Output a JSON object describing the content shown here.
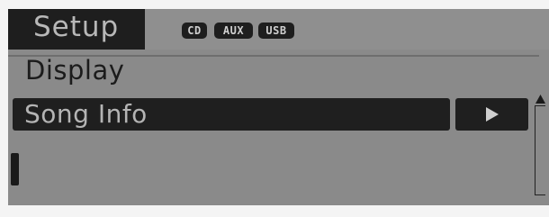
{
  "header": {
    "mode_title": "Setup",
    "badges": {
      "cd": "CD",
      "aux": "AUX",
      "usb": "USB"
    }
  },
  "menu": {
    "title": "Display",
    "items": [
      {
        "label": "Song Info",
        "selected": true,
        "has_submenu": true
      }
    ]
  },
  "icons": {
    "submenu_arrow": "play-right-icon",
    "scroll_up": "triangle-up-icon"
  },
  "colors": {
    "screen_bg": "#8a8a8a",
    "highlight_bg": "#1f1f1f",
    "highlight_text": "#b4b4b4",
    "text_dark": "#1c1c1c"
  }
}
